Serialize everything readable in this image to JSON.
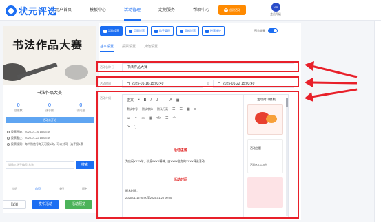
{
  "header": {
    "logo": "状元评选",
    "nav": [
      "用户首页",
      "模板中心",
      "活动管理",
      "定制服务",
      "帮助中心"
    ],
    "active_nav": 2,
    "create_button": "创建活动",
    "vip_badge": "VIP",
    "vip_label": "会员升级"
  },
  "preview": {
    "banner_title": "书法作品大赛",
    "activity_name": "书法作品大赛",
    "stats": [
      {
        "num": "0",
        "label": "总票数"
      },
      {
        "num": "0",
        "label": "选手数"
      },
      {
        "num": "0",
        "label": "访问量"
      }
    ],
    "status": "活动未开始",
    "info": [
      "投票开始：2025-01-16 15:03:49",
      "投票截止：2025-01-22 15:03:49",
      "投票规则：每个微信号每天可投1次，可以对同一选手投1票"
    ],
    "search_placeholder": "请输入选手编号/名称",
    "search_button": "搜索",
    "bottom_tabs": [
      "介绍",
      "首页",
      "排行",
      "报名"
    ],
    "active_bottom_tab": 1,
    "buttons": {
      "cancel": "取消",
      "publish": "发布活动",
      "preview": "活动预览"
    }
  },
  "panel": {
    "tools": [
      "活动设置",
      "页面设置",
      "选手管理",
      "风格设置",
      "投票统计"
    ],
    "active_tool": 0,
    "preview_toggle_label": "预览效果",
    "subtabs": [
      "基本设置",
      "投票设置",
      "其他设置"
    ],
    "active_subtab": 0,
    "name_label": "活动名称 ⓘ",
    "name_value": "书法作品大赛",
    "time_label": "活动时间",
    "start_time": "2025-01-16 15:03:49",
    "time_sep": "至",
    "end_time": "2025-01-22 15:03:49",
    "intro_label": "活动介绍",
    "toolbar_rows": [
      [
        "正文",
        "❝",
        "B",
        "I",
        "U",
        "···",
        "A",
        "▦"
      ],
      [
        "默认字号",
        "默认字体",
        "默认行高",
        "☰",
        "☷",
        "▦",
        "≡"
      ],
      [
        "☺",
        "⚭",
        "▭",
        "▦",
        "</>",
        "☰",
        "↶"
      ],
      [
        "↷",
        "⛶"
      ]
    ],
    "doc": {
      "heading1": "活动主题",
      "para1": "为庆祝XXXX节，弘扬XXXX精神，由XXXX主办的XXXX评选活动。",
      "heading2": "活动时间",
      "para2": "报名时间：",
      "para3": "2025-01-15 00:00至2025-01-20 00:00"
    },
    "template_panel_title": "活动简介模板",
    "templates": [
      "活动主题",
      "活动XXXXX节"
    ]
  },
  "colors": {
    "accent": "#1c6ef2",
    "highlight": "#e8202a",
    "orange": "#ff8a00",
    "green": "#4cb35a"
  }
}
